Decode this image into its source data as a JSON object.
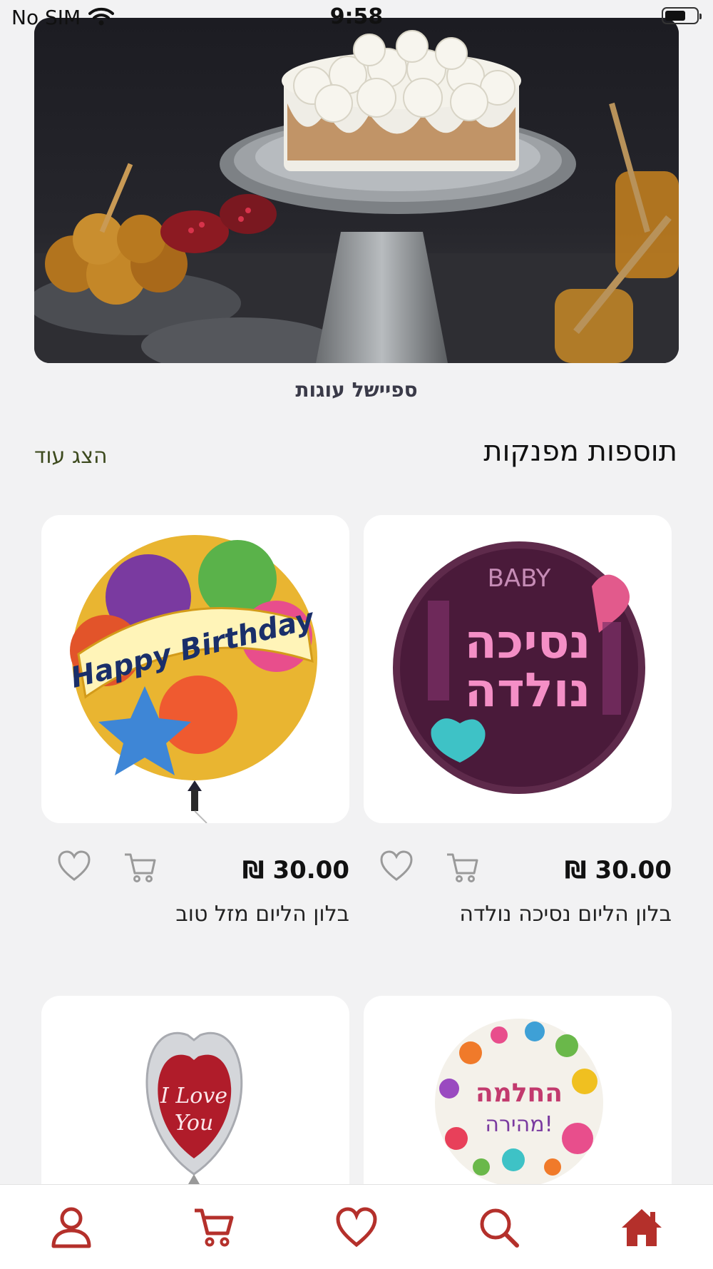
{
  "status_bar": {
    "carrier": "No SIM",
    "time": "9:58"
  },
  "hero": {
    "caption": "ספיישל עוגות",
    "image": "cake-on-stand-photo"
  },
  "section": {
    "title": "תוספות מפנקות",
    "show_more": "הצג עוד"
  },
  "products": [
    {
      "name": "בלון הליום נסיכה נולדה",
      "price": "30.00 ₪",
      "image": "baby-princess-balloon"
    },
    {
      "name": "בלון הליום מזל טוב",
      "price": "30.00 ₪",
      "image": "happy-birthday-balloon"
    },
    {
      "name": "",
      "price": "",
      "image": "fast-recovery-balloon",
      "balloon_text": [
        "החלמה",
        "מהירה!"
      ]
    },
    {
      "name": "",
      "price": "",
      "image": "i-love-you-heart-balloon",
      "balloon_text": [
        "I Love",
        "You"
      ]
    }
  ],
  "balloon_text": {
    "princess": [
      "נסיכה",
      "נולדה",
      "BABY"
    ],
    "birthday": "Happy Birthday"
  },
  "bottom_nav": [
    {
      "icon": "home-icon",
      "active": true
    },
    {
      "icon": "search-icon"
    },
    {
      "icon": "heart-icon"
    },
    {
      "icon": "cart-icon"
    },
    {
      "icon": "user-icon"
    }
  ],
  "colors": {
    "accent": "#b4302b",
    "background": "#f2f2f3",
    "icon_gray": "#9a9a9a"
  }
}
